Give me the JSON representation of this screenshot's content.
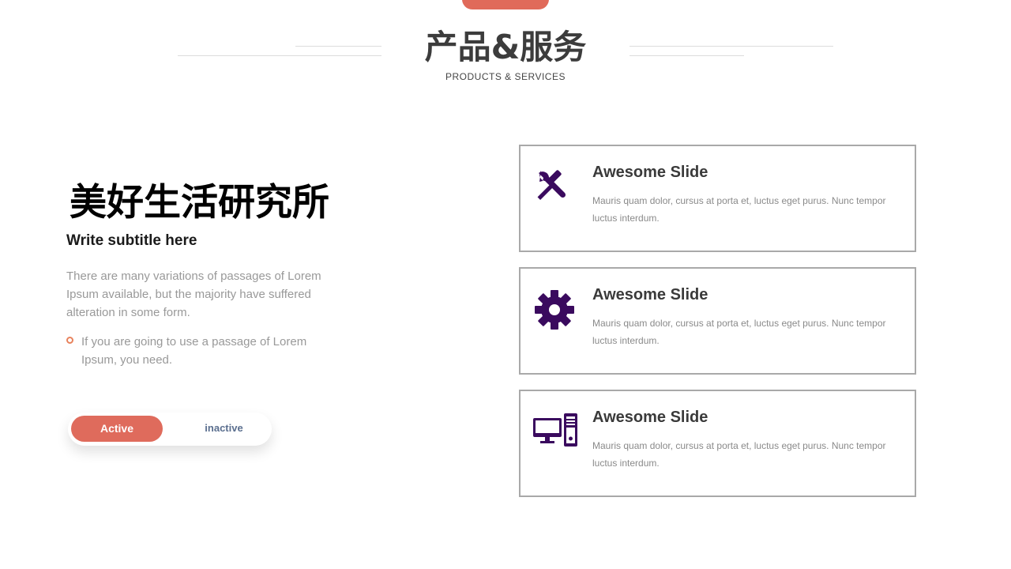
{
  "header": {
    "title": "产品&服务",
    "subtitle": "PRODUCTS  &  SERVICES"
  },
  "left": {
    "heading": "美好生活研究所",
    "subtitle": "Write subtitle here",
    "paragraph": "There are many variations of passages of Lorem Ipsum available, but the majority have suffered alteration in some form.",
    "bullet": "If you are going to use a passage of Lorem Ipsum, you need."
  },
  "toggle": {
    "active_label": "Active",
    "inactive_label": "inactive"
  },
  "cards": [
    {
      "icon": "tools-icon",
      "title": "Awesome Slide",
      "text": "Mauris quam dolor, cursus at porta et, luctus eget purus. Nunc tempor luctus interdum."
    },
    {
      "icon": "gear-icon",
      "title": "Awesome Slide",
      "text": "Mauris quam dolor, cursus at porta et, luctus eget purus. Nunc tempor luctus interdum."
    },
    {
      "icon": "computer-icon",
      "title": "Awesome Slide",
      "text": "Mauris quam dolor, cursus at porta et, luctus eget purus. Nunc tempor luctus interdum."
    }
  ],
  "colors": {
    "accent": "#e06a5a",
    "icon": "#3a0a5e",
    "border": "#a9a9a9",
    "inactive_text": "#5b6f8f"
  }
}
